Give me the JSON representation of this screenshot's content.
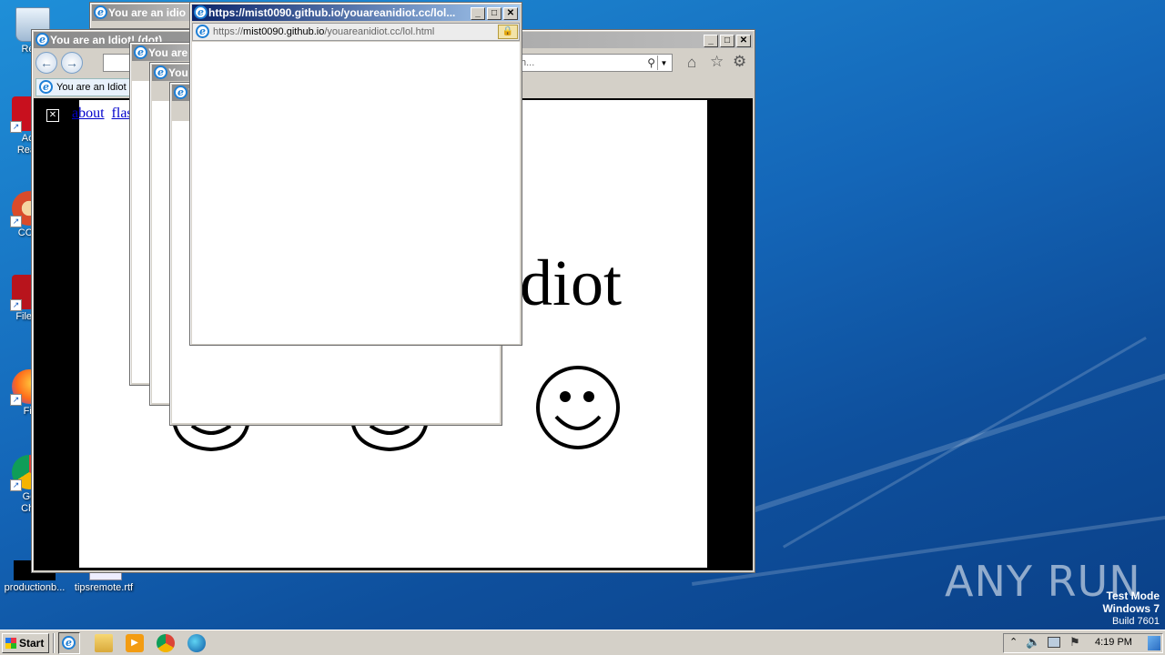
{
  "desktop": {
    "icons": [
      {
        "name": "recycle-bin",
        "label": "Recy"
      },
      {
        "name": "acrobat-reader",
        "label": "Acr\nRead"
      },
      {
        "name": "ccleaner",
        "label": "CCle"
      },
      {
        "name": "filezilla",
        "label": "FileZil"
      },
      {
        "name": "firefox",
        "label": "Fir"
      },
      {
        "name": "google-chrome",
        "label": "Go\nChr"
      },
      {
        "name": "productionb",
        "label": "productionb..."
      },
      {
        "name": "tipsremote",
        "label": "tipsremote.rtf"
      }
    ],
    "watermark": "ANY RUN",
    "test_mode": {
      "line1": "Test Mode",
      "line2": "Windows 7",
      "line3": "Build 7601"
    }
  },
  "main_window": {
    "title": "You are an Idiot! (dot) ...",
    "tab_label": "You are an Idiot",
    "search_placeholder": "h...",
    "links": [
      "about",
      "flash"
    ],
    "heading_fragment": "diot"
  },
  "stacked_windows": [
    {
      "title": "You are an idio"
    },
    {
      "title": "You are"
    },
    {
      "title": "You"
    },
    {
      "title": "Y"
    }
  ],
  "front_popup": {
    "title": "https://mist0090.github.io/youareanidiot.cc/lol...",
    "address_prefix": "https://",
    "address_host": "mist0090.github.io",
    "address_path": "/youareanidiot.cc/lol.html"
  },
  "taskbar": {
    "start_label": "Start",
    "clock": "4:19 PM"
  }
}
